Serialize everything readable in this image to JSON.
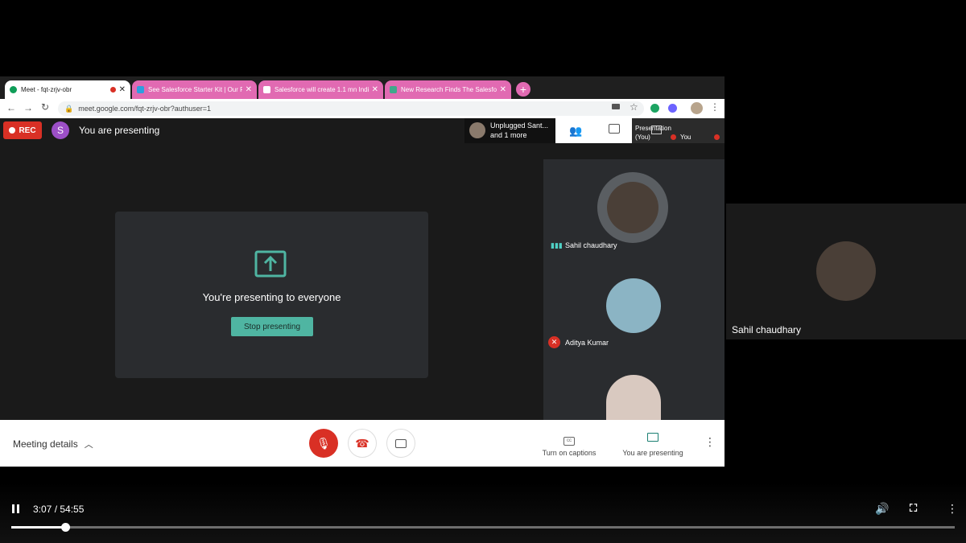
{
  "browser": {
    "tabs": [
      {
        "title": "Meet - fqt-zrjv-obr",
        "active": true
      },
      {
        "title": "See Salesforce Starter Kit | Our Fr",
        "active": false
      },
      {
        "title": "Salesforce will create 1.1 mn Indi",
        "active": false
      },
      {
        "title": "New Research Finds The Salesforc",
        "active": false
      }
    ],
    "new_tab_icon": "plus-icon",
    "url": "meet.google.com/fqt-zrjv-obr?authuser=1"
  },
  "meet": {
    "rec_label": "REC",
    "presenter_initial": "S",
    "presenting_status": "You are presenting",
    "presentation_panel": {
      "message": "You're presenting to everyone",
      "stop_button": "Stop presenting"
    },
    "top_strip": {
      "participant_line1": "Unplugged Sant...",
      "participant_line2": "and 1 more",
      "presentation_label": "Presentation",
      "presentation_sub": "(You)",
      "you_label": "You"
    },
    "participants": [
      {
        "name": "Sahil chaudhary",
        "speaking": true,
        "muted": false
      },
      {
        "name": "Aditya Kumar",
        "speaking": false,
        "muted": true
      },
      {
        "name": "",
        "speaking": false,
        "muted": false
      }
    ],
    "bottom_bar": {
      "meeting_details": "Meeting details",
      "captions_label": "Turn on captions",
      "presenting_label": "You are presenting"
    },
    "colors": {
      "rec": "#d93025",
      "accent": "#4fb5a2",
      "avatar": "#9c4fc7"
    }
  },
  "side_tile": {
    "name": "Sahil chaudhary"
  },
  "player": {
    "time": "3:07 / 54:55",
    "progress": 0.057
  }
}
